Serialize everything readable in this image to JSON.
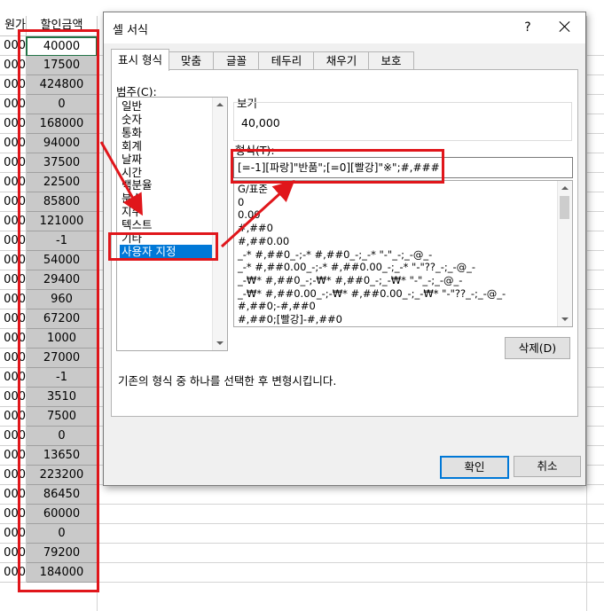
{
  "sheet": {
    "header_left": "원가",
    "header_main": "할인금액",
    "col_a_value": "000",
    "values": [
      "40000",
      "17500",
      "424800",
      "0",
      "168000",
      "94000",
      "37500",
      "22500",
      "85800",
      "121000",
      "-1",
      "54000",
      "29400",
      "960",
      "67200",
      "1000",
      "27000",
      "-1",
      "3510",
      "7500",
      "0",
      "13650",
      "223200",
      "86450",
      "60000",
      "0",
      "79200",
      "184000"
    ]
  },
  "dialog": {
    "title": "셀 서식",
    "help": "?",
    "tabs": [
      "표시 형식",
      "맞춤",
      "글꼴",
      "테두리",
      "채우기",
      "보호"
    ],
    "category_label": "범주(C):",
    "categories": [
      "일반",
      "숫자",
      "통화",
      "회계",
      "날짜",
      "시간",
      "백분율",
      "분수",
      "지수",
      "텍스트",
      "기타",
      "사용자 지정"
    ],
    "selected_category": "사용자 지정",
    "sample_label": "보기",
    "sample_value": "40,000",
    "format_label": "형식(T):",
    "format_value": "[=-1][파랑]\"반품\";[=0][빨강]\"※\";#,###",
    "format_list": [
      "G/표준",
      "0",
      "0.00",
      "#,##0",
      "#,##0.00",
      "_-* #,##0_-;-* #,##0_-;_-* \"-\"_-;_-@_-",
      "_-* #,##0.00_-;-* #,##0.00_-;_-* \"-\"??_-;_-@_-",
      "_-₩* #,##0_-;-₩* #,##0_-;_-₩* \"-\"_-;_-@_-",
      "_-₩* #,##0.00_-;-₩* #,##0.00_-;_-₩* \"-\"??_-;_-@_-",
      "#,##0;-#,##0",
      "#,##0;[빨강]-#,##0"
    ],
    "delete_label": "삭제(D)",
    "description": "기존의 형식 중 하나를 선택한 후 변형시킵니다.",
    "ok_label": "확인",
    "cancel_label": "취소"
  },
  "colors": {
    "highlight_red": "#e0161b",
    "selection_blue": "#0078d7",
    "cell_gray": "#c9c9c9",
    "active_cell_green": "#217346"
  }
}
